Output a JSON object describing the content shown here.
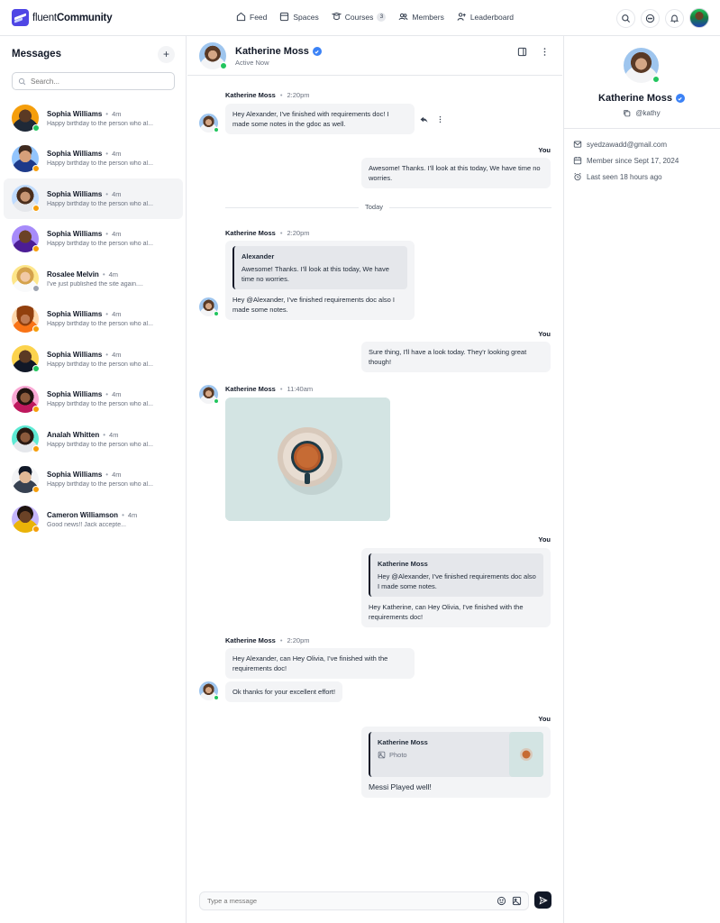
{
  "app": {
    "logo_light": "fluent",
    "logo_bold": "Community"
  },
  "nav": [
    {
      "label": "Feed",
      "icon": "home-icon"
    },
    {
      "label": "Spaces",
      "icon": "spaces-icon"
    },
    {
      "label": "Courses",
      "icon": "courses-icon",
      "badge": "3"
    },
    {
      "label": "Members",
      "icon": "members-icon"
    },
    {
      "label": "Leaderboard",
      "icon": "leaderboard-icon"
    }
  ],
  "sidebar": {
    "title": "Messages",
    "add_label": "+",
    "search_placeholder": "Search...",
    "conversations": [
      {
        "name": "Sophia Williams",
        "time": "4m",
        "preview": "Happy birthday to the person who al...",
        "status": "online",
        "avatar": "av-dark"
      },
      {
        "name": "Sophia Williams",
        "time": "4m",
        "preview": "Happy birthday to the person who al...",
        "status": "away",
        "avatar": "av-man"
      },
      {
        "name": "Sophia Williams",
        "time": "4m",
        "preview": "Happy birthday to the person who al...",
        "status": "away",
        "avatar": "av-woman",
        "active": true
      },
      {
        "name": "Sophia Williams",
        "time": "4m",
        "preview": "Happy birthday to the person who al...",
        "status": "away",
        "avatar": "av-purple"
      },
      {
        "name": "Rosalee Melvin",
        "time": "4m",
        "preview": "I've just published the site again....",
        "status": "offline",
        "avatar": "av-blonde"
      },
      {
        "name": "Sophia Williams",
        "time": "4m",
        "preview": "Happy birthday to the person who al...",
        "status": "away",
        "avatar": "av-hat"
      },
      {
        "name": "Sophia Williams",
        "time": "4m",
        "preview": "Happy birthday to the person who al...",
        "status": "online",
        "avatar": "av-yellow"
      },
      {
        "name": "Sophia Williams",
        "time": "4m",
        "preview": "Happy birthday to the person who al...",
        "status": "away",
        "avatar": "av-pink"
      },
      {
        "name": "Analah Whitten",
        "time": "4m",
        "preview": "Happy birthday to the person who al...",
        "status": "away",
        "avatar": "av-teal"
      },
      {
        "name": "Sophia Williams",
        "time": "4m",
        "preview": "Happy birthday to the person who al...",
        "status": "away",
        "avatar": "av-gray"
      },
      {
        "name": "Cameron Williamson",
        "time": "4m",
        "preview": "Good news!! Jack accepte...",
        "status": "away",
        "avatar": "av-lav"
      }
    ]
  },
  "chat": {
    "contact_name": "Katherine Moss",
    "contact_status": "Active Now",
    "you_label": "You",
    "day_label": "Today",
    "composer_placeholder": "Type a message",
    "messages": {
      "m1_sender": "Katherine Moss",
      "m1_time": "2:20pm",
      "m1_text": "Hey Alexander, I've finished with requirements doc! I made some notes in the gdoc as well.",
      "m2_text": "Awesome! Thanks. I'll look at this today, We have time no worries.",
      "m3_sender": "Katherine Moss",
      "m3_time": "2:20pm",
      "m3_quote_name": "Alexander",
      "m3_quote_text": "Awesome! Thanks. I'll look at this today, We have time no worries.",
      "m3_text": "Hey @Alexander, I've finished requirements doc also I made some notes.",
      "m4_text": "Sure thing, I'll have a look today. They'r looking great though!",
      "m5_sender": "Katherine Moss",
      "m5_time": "11:40am",
      "m6_quote_name": "Katherine Moss",
      "m6_quote_text": "Hey @Alexander, I've finished requirements doc also I made some notes.",
      "m6_text": "Hey Katherine, can Hey Olivia, I've finished with the requirements doc!",
      "m7_sender": "Katherine Moss",
      "m7_time": "2:20pm",
      "m7_text": "Hey Alexander, can Hey Olivia, I've finished with the requirements doc!",
      "m8_text": "Ok thanks for your excellent effort!",
      "m9_quote_name": "Katherine Moss",
      "m9_quote_text": "Photo",
      "m9_text": "Messi Played well!"
    }
  },
  "profile": {
    "name": "Katherine Moss",
    "handle": "@kathy",
    "email": "syedzawadd@gmail.com",
    "member_since": "Member since Sept 17, 2024",
    "last_seen": "Last seen 18 hours ago"
  },
  "colors": {
    "brand": "#4f46e5",
    "online": "#22c55e",
    "away": "#f59e0b",
    "offline": "#9ca3af",
    "verified": "#3b82f6"
  }
}
